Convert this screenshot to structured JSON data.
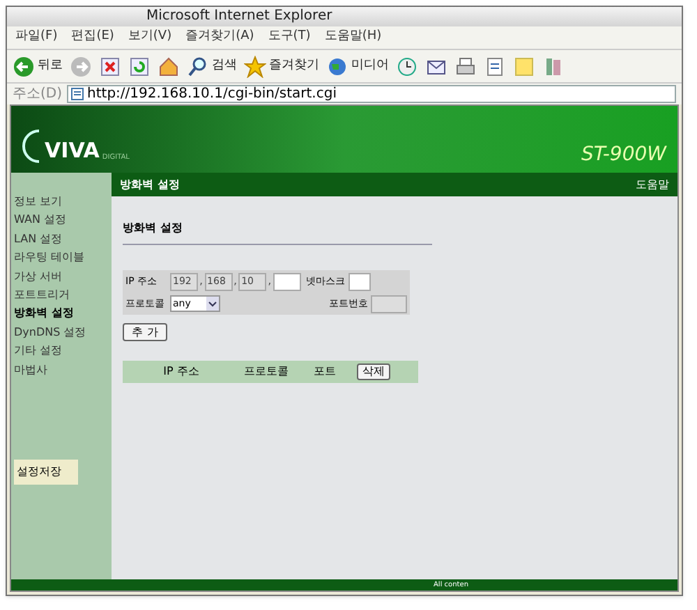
{
  "window": {
    "title": "Microsoft Internet Explorer"
  },
  "menu": [
    "파일(F)",
    "편집(E)",
    "보기(V)",
    "즐겨찾기(A)",
    "도구(T)",
    "도움말(H)"
  ],
  "toolbar": [
    {
      "kind": "back",
      "label": "뒤로"
    },
    {
      "kind": "forward"
    },
    {
      "kind": "stop"
    },
    {
      "kind": "refresh"
    },
    {
      "kind": "home"
    },
    {
      "kind": "search",
      "label": "검색"
    },
    {
      "kind": "favorites",
      "label": "즐겨찾기"
    },
    {
      "kind": "media",
      "label": "미디어"
    },
    {
      "kind": "history"
    },
    {
      "kind": "mail"
    },
    {
      "kind": "print"
    },
    {
      "kind": "edit"
    },
    {
      "kind": "note"
    },
    {
      "kind": "messenger"
    }
  ],
  "address": {
    "label": "주소(D)",
    "url": "http://192.168.10.1/cgi-bin/start.cgi"
  },
  "banner": {
    "logo": "VIVA",
    "logo_sub": "DIGITAL",
    "model": "ST-900W"
  },
  "header": {
    "title": "방화벽 설정",
    "help": "도움말"
  },
  "sidebar": {
    "items": [
      {
        "label": "정보 보기",
        "selected": false
      },
      {
        "label": "WAN 설정",
        "selected": false
      },
      {
        "label": "LAN 설정",
        "selected": false
      },
      {
        "label": "라우팅 테이블",
        "selected": false
      },
      {
        "label": "가상 서버",
        "selected": false
      },
      {
        "label": "포트트리거",
        "selected": false
      },
      {
        "label": "방화벽 설정",
        "selected": true
      },
      {
        "label": "DynDNS 설정",
        "selected": false
      },
      {
        "label": "기타 설정",
        "selected": false
      },
      {
        "label": "마법사",
        "selected": false
      }
    ],
    "save": "설정저장"
  },
  "form": {
    "heading": "방화벽 설정",
    "ip_label": "IP 주소",
    "ip": [
      {
        "value": "192",
        "disabled": true
      },
      {
        "value": "168",
        "disabled": true
      },
      {
        "value": "10",
        "disabled": true
      },
      {
        "disabled": false
      }
    ],
    "ip_separator": ",",
    "mask_label": "넷마스크",
    "protocol_label": "프로토콜",
    "protocol": "any",
    "port_label": "포트번호",
    "add": "추 가"
  },
  "table": {
    "columns": [
      "IP 주소",
      "프로토콜",
      "포트"
    ],
    "delete": "삭제"
  },
  "footer": "All conten"
}
